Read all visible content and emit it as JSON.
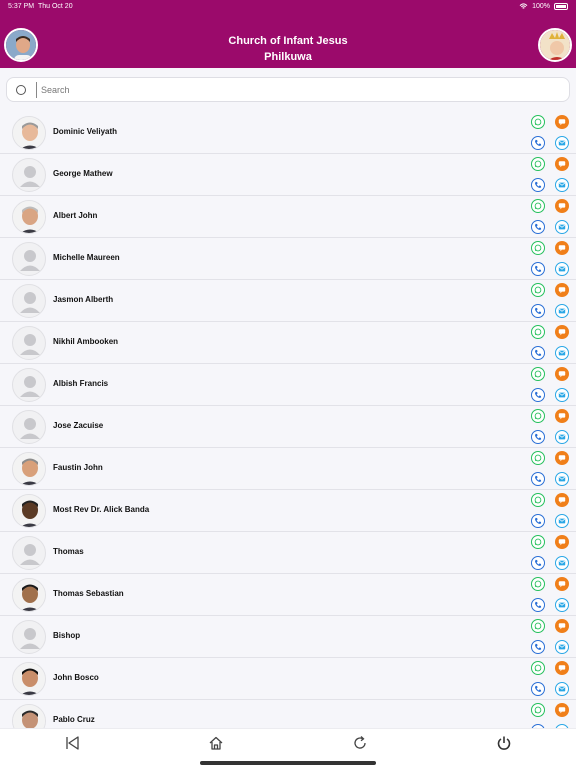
{
  "status": {
    "time": "5:37 PM",
    "date": "Thu Oct 20",
    "battery": "100%"
  },
  "header": {
    "title": "Church of Infant Jesus",
    "subtitle": "Philkuwa"
  },
  "search": {
    "placeholder": "Search"
  },
  "contacts": [
    {
      "name": "Dominic Veliyath",
      "photo": "photo",
      "skin": "#e7b99a",
      "hair": "#9a9a9a"
    },
    {
      "name": "George Mathew",
      "photo": "placeholder"
    },
    {
      "name": "Albert John",
      "photo": "photo",
      "skin": "#d9a583",
      "hair": "#bdbdbd"
    },
    {
      "name": "Michelle Maureen",
      "photo": "placeholder"
    },
    {
      "name": "Jasmon Alberth",
      "photo": "placeholder"
    },
    {
      "name": "Nikhil Ambooken",
      "photo": "placeholder"
    },
    {
      "name": "Albish Francis",
      "photo": "placeholder"
    },
    {
      "name": "Jose Zacuise",
      "photo": "placeholder"
    },
    {
      "name": "Faustin John",
      "photo": "photo",
      "skin": "#d8a07a",
      "hair": "#8c8c8c"
    },
    {
      "name": "Most Rev Dr. Alick Banda",
      "photo": "photo",
      "skin": "#5a3a25",
      "hair": "#222222"
    },
    {
      "name": "Thomas",
      "photo": "placeholder"
    },
    {
      "name": "Thomas Sebastian",
      "photo": "photo",
      "skin": "#a0704c",
      "hair": "#1a1a1a"
    },
    {
      "name": "Bishop",
      "photo": "placeholder"
    },
    {
      "name": "John Bosco",
      "photo": "photo",
      "skin": "#c98e6a",
      "hair": "#111111"
    },
    {
      "name": "Pablo Cruz",
      "photo": "photo",
      "skin": "#c49276",
      "hair": "#2a2a2a"
    }
  ],
  "actions": [
    "whatsapp-icon",
    "message-icon",
    "phone-icon",
    "mail-icon"
  ],
  "tabs": [
    "back-icon",
    "home-icon",
    "refresh-icon",
    "power-icon"
  ],
  "colors": {
    "brand": "#9b0a6b",
    "whatsapp": "#25c05c",
    "message": "#f07f1a",
    "phone": "#2a6fd6",
    "mail": "#2aa7e6"
  }
}
